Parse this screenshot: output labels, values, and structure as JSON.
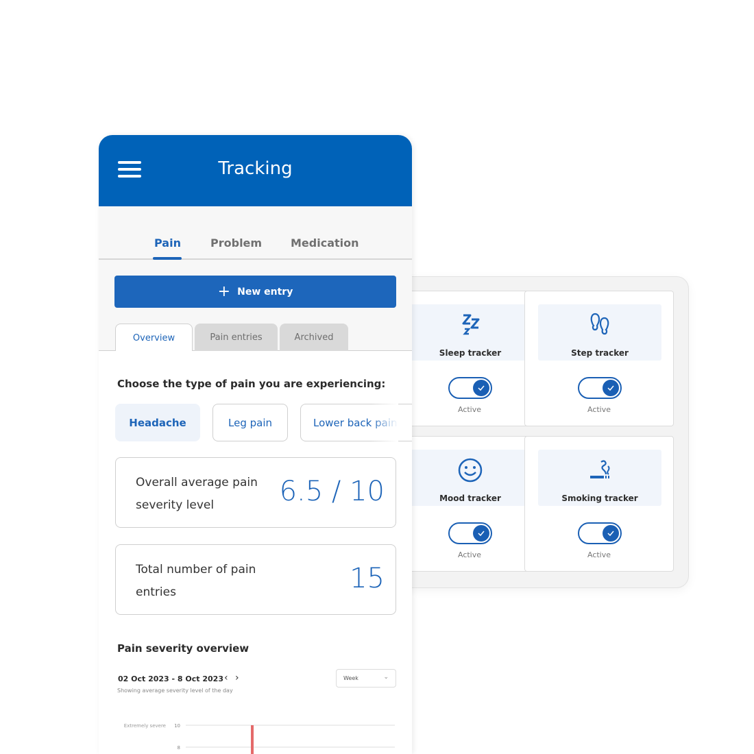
{
  "header": {
    "title": "Tracking",
    "menu_icon": "hamburger-icon"
  },
  "top_tabs": [
    {
      "label": "Pain",
      "active": true
    },
    {
      "label": "Problem",
      "active": false
    },
    {
      "label": "Medication",
      "active": false
    }
  ],
  "new_entry": {
    "label": "New entry",
    "icon": "plus-icon"
  },
  "sub_tabs": [
    {
      "label": "Overview",
      "active": true
    },
    {
      "label": "Pain entries",
      "active": false
    },
    {
      "label": "Archived",
      "active": false
    }
  ],
  "pain_type": {
    "prompt": "Choose the type of pain you are experiencing:",
    "chips": [
      {
        "label": "Headache",
        "selected": true
      },
      {
        "label": "Leg pain",
        "selected": false
      },
      {
        "label": "Lower back pain",
        "selected": false
      }
    ]
  },
  "stats": [
    {
      "label": "Overall average pain severity level",
      "value": "6.5 / 10"
    },
    {
      "label": "Total number of pain entries",
      "value": "15"
    }
  ],
  "severity_overview": {
    "title": "Pain severity overview",
    "date_range": "02 Oct 2023 -  8 Oct 2023",
    "subtitle": "Showing average severity level of the day",
    "period": "Week"
  },
  "chart_data": {
    "type": "bar",
    "title": "Pain severity overview",
    "ylabel": "",
    "y_ticks": [
      10,
      8
    ],
    "y_tick_labels": {
      "10": "Extremely severe"
    },
    "ylim": [
      0,
      10
    ],
    "visible_bars": [
      {
        "value": 10,
        "color": "#e46a6a"
      }
    ],
    "grid": true
  },
  "trackers": [
    {
      "label": "Sleep tracker",
      "icon": "sleep-icon",
      "status": "Active",
      "enabled": true
    },
    {
      "label": "Step tracker",
      "icon": "footsteps-icon",
      "status": "Active",
      "enabled": true
    },
    {
      "label": "Mood tracker",
      "icon": "smiley-icon",
      "status": "Active",
      "enabled": true
    },
    {
      "label": "Smoking tracker",
      "icon": "smoking-icon",
      "status": "Active",
      "enabled": true
    }
  ],
  "colors": {
    "primary": "#0062b8",
    "accent": "#1d64b8",
    "bar": "#e46a6a"
  }
}
